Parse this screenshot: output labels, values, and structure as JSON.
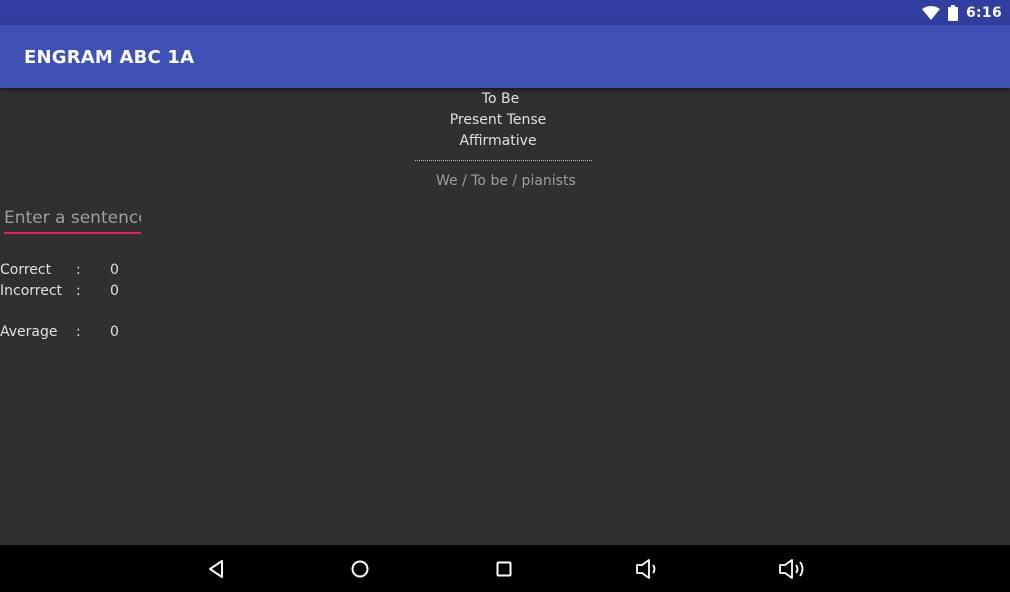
{
  "status_bar": {
    "time": "6:16",
    "icons": [
      "wifi-icon",
      "battery-icon"
    ]
  },
  "app_bar": {
    "title": "ENGRAM ABC 1A"
  },
  "lesson": {
    "title": "To Be",
    "tense": "Present Tense",
    "form": "Affirmative",
    "prompt": "We / To be / pianists"
  },
  "input": {
    "placeholder": "Enter a sentence",
    "value": ""
  },
  "stats": [
    {
      "label": "Correct",
      "separator": ":",
      "value": "0"
    },
    {
      "label": "Incorrect",
      "separator": ":",
      "value": "0"
    },
    {
      "label": "Average",
      "separator": ":",
      "value": "0"
    }
  ],
  "nav_bar": {
    "buttons": [
      "back-icon",
      "home-icon",
      "recents-icon",
      "volume-down-icon",
      "volume-up-icon"
    ]
  },
  "colors": {
    "status_bar": "#303F9F",
    "app_bar": "#3F51B5",
    "background": "#303030",
    "accent": "#E91E63",
    "nav_bar": "#000000"
  }
}
